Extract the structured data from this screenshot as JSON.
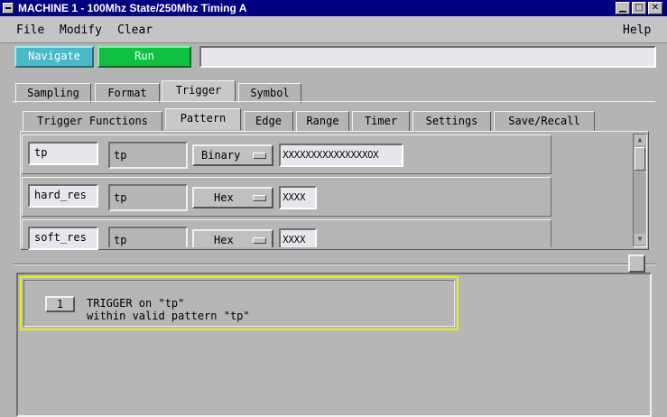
{
  "window": {
    "title": "MACHINE 1 - 100Mhz State/250Mhz Timing A"
  },
  "menubar": {
    "file": "File",
    "modify": "Modify",
    "clear": "Clear",
    "help": "Help"
  },
  "toolbar": {
    "navigate_label": "Navigate",
    "run_label": "Run",
    "status_text": ""
  },
  "tabs_main": [
    "Sampling",
    "Format",
    "Trigger",
    "Symbol"
  ],
  "tabs_trigger": [
    "Trigger Functions",
    "Pattern",
    "Edge",
    "Range",
    "Timer",
    "Settings",
    "Save/Recall"
  ],
  "patterns": [
    {
      "label": "tp",
      "name": "tp",
      "base": "Binary",
      "value": "XXXXXXXXXXXXXXX0X"
    },
    {
      "label": "hard_res",
      "name": "tp",
      "base": "Hex",
      "value": "XXXX"
    },
    {
      "label": "soft_res",
      "name": "tp",
      "base": "Hex",
      "value": "XXXX"
    }
  ],
  "sequence": {
    "step_number": "1",
    "line1": "TRIGGER on \"tp\"",
    "line2": "within valid pattern \"tp\""
  },
  "colors": {
    "titlebar": "#000080",
    "navigate": "#4ab8c8",
    "run": "#10c040",
    "highlight": "#f0f000"
  }
}
